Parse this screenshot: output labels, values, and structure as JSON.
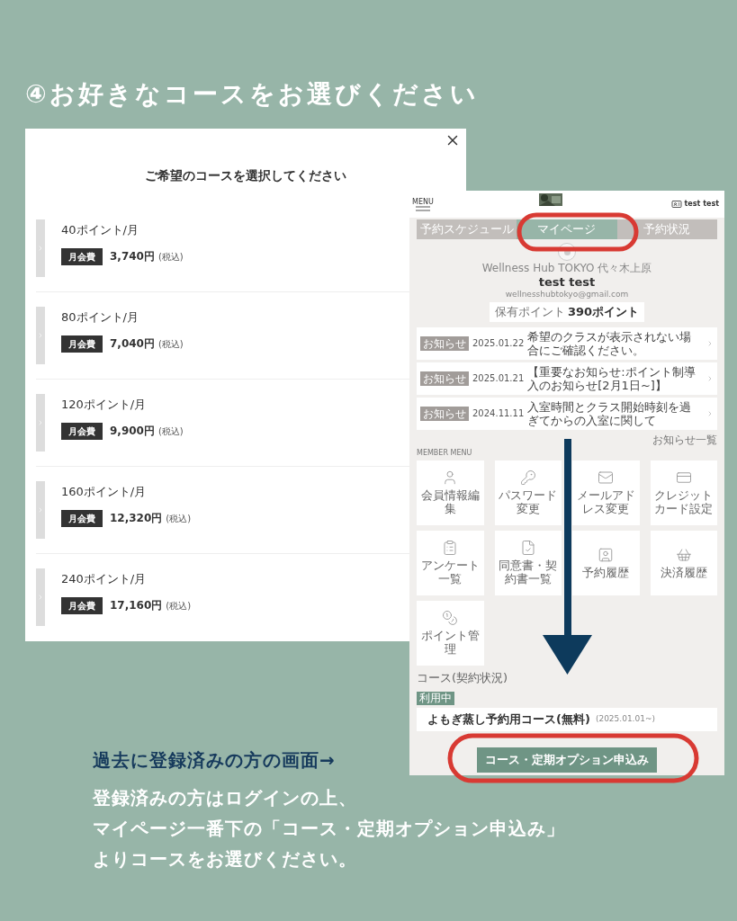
{
  "heading": "④お好きなコースをお選びください",
  "course_dialog": {
    "title": "ご希望のコースを選択してください",
    "courses": [
      {
        "name": "40ポイント/月",
        "fee_label": "月会費",
        "price": "3,740円",
        "tax_note": "(税込)"
      },
      {
        "name": "80ポイント/月",
        "fee_label": "月会費",
        "price": "7,040円",
        "tax_note": "(税込)"
      },
      {
        "name": "120ポイント/月",
        "fee_label": "月会費",
        "price": "9,900円",
        "tax_note": "(税込)"
      },
      {
        "name": "160ポイント/月",
        "fee_label": "月会費",
        "price": "12,320円",
        "tax_note": "(税込)"
      },
      {
        "name": "240ポイント/月",
        "fee_label": "月会費",
        "price": "17,160円",
        "tax_note": "(税込)"
      }
    ]
  },
  "mypage_screen": {
    "menu_label": "MENU",
    "user": "test test",
    "tabs": [
      {
        "label": "予約スケジュール",
        "selected": false
      },
      {
        "label": "マイページ",
        "selected": true
      },
      {
        "label": "予約状況",
        "selected": false
      }
    ],
    "shop_name": "Wellness Hub TOKYO 代々木上原",
    "member_name": "test test",
    "email": "wellnesshubtokyo@gmail.com",
    "points_label": "保有ポイント",
    "points": "390ポイント",
    "notices": [
      {
        "badge": "お知らせ",
        "date": "2025.01.22",
        "title": "希望のクラスが表示されない場合にご確認ください。"
      },
      {
        "badge": "お知らせ",
        "date": "2025.01.21",
        "title": "【重要なお知らせ:ポイント制導入のお知らせ[2月1日~]】"
      },
      {
        "badge": "お知らせ",
        "date": "2024.11.11",
        "title": "入室時間とクラス開始時刻を過ぎてからの入室に関して"
      }
    ],
    "notices_link": "お知らせ一覧",
    "member_menu_title": "MEMBER MENU",
    "menu_tiles": [
      {
        "label": "会員情報編集",
        "kind": "user"
      },
      {
        "label": "パスワード変更",
        "kind": "key"
      },
      {
        "label": "メールアドレス変更",
        "kind": "mail"
      },
      {
        "label": "クレジットカード設定",
        "kind": "card"
      },
      {
        "label": "アンケート一覧",
        "kind": "list"
      },
      {
        "label": "同意書・契約書一覧",
        "kind": "check"
      },
      {
        "label": "予約履歴",
        "kind": "contact"
      },
      {
        "label": "決済履歴",
        "kind": "basket"
      },
      {
        "label": "ポイント管理",
        "kind": "coins"
      }
    ],
    "course_section_label": "コース(契約状況)",
    "current_course": {
      "badge": "利用中",
      "name": "よもぎ蒸し予約用コース(無料)",
      "since": "(2025.01.01~)"
    },
    "apply_button": "コース・定期オプション申込み"
  },
  "caption": {
    "title": "過去に登録済みの方の画面→",
    "lines": [
      "登録済みの方はログインの上、",
      "マイページ一番下の「コース・定期オプション申込み」",
      "よりコースをお選びください。"
    ]
  }
}
